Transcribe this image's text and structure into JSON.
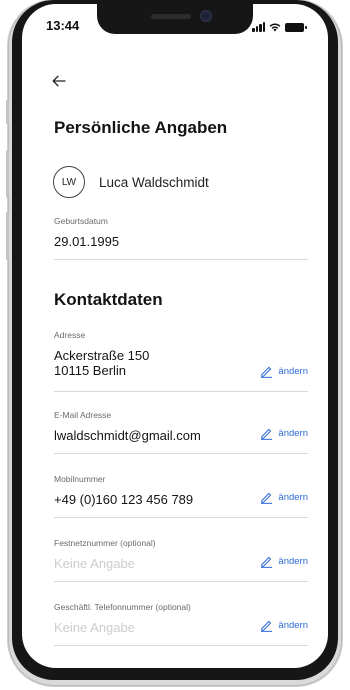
{
  "status_bar": {
    "time": "13:44"
  },
  "navigation": {
    "back_icon": "arrow-left-icon"
  },
  "personal": {
    "heading": "Persönliche Angaben",
    "avatar_initials": "LW",
    "name": "Luca Waldschmidt",
    "birthdate_label": "Geburtsdatum",
    "birthdate_value": "29.01.1995"
  },
  "contact": {
    "heading": "Kontaktdaten",
    "edit_label": "ändern",
    "address": {
      "label": "Adresse",
      "line1": "Ackerstraße 150",
      "line2": "10115 Berlin"
    },
    "email": {
      "label": "E-Mail Adresse",
      "value": "lwaldschmidt@gmail.com"
    },
    "mobile": {
      "label": "Mobilnummer",
      "value": "+49 (0)160 123 456 789"
    },
    "landline": {
      "label": "Festnetznummer (optional)",
      "value": "Keine Angabe"
    },
    "business_phone": {
      "label": "Geschäftl. Telefonnummer (optional)",
      "value": "Keine Angabe"
    }
  },
  "colors": {
    "accent": "#2f6bd9",
    "placeholder": "#cdcdcd",
    "divider": "#d8d8d8"
  }
}
